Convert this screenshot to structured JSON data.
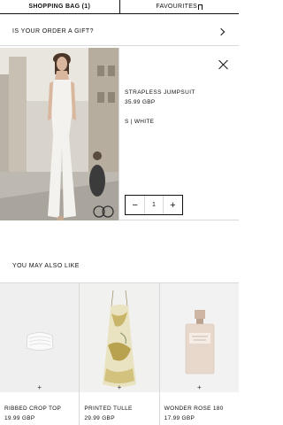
{
  "tabs": {
    "bag_label": "SHOPPING BAG (1)",
    "favourites_label": "FAVOURITES"
  },
  "gift": {
    "label": "IS YOUR ORDER A GIFT?"
  },
  "cart_item": {
    "name": "STRAPLESS JUMPSUIT",
    "price": "35.99 GBP",
    "variant": "S | WHITE",
    "quantity": "1",
    "minus": "−",
    "plus": "+"
  },
  "recommendations": {
    "title": "YOU MAY ALSO LIKE",
    "items": [
      {
        "name": "RIBBED CROP TOP",
        "price": "19.99 GBP",
        "add": "+"
      },
      {
        "name": "PRINTED TULLE",
        "price": "29.99 GBP",
        "add": "+"
      },
      {
        "name": "WONDER ROSE 180",
        "price": "17.99 GBP",
        "add": "+"
      }
    ]
  },
  "colors": {
    "text": "#111111",
    "divider": "#d9d9d9",
    "background": "#ffffff"
  }
}
